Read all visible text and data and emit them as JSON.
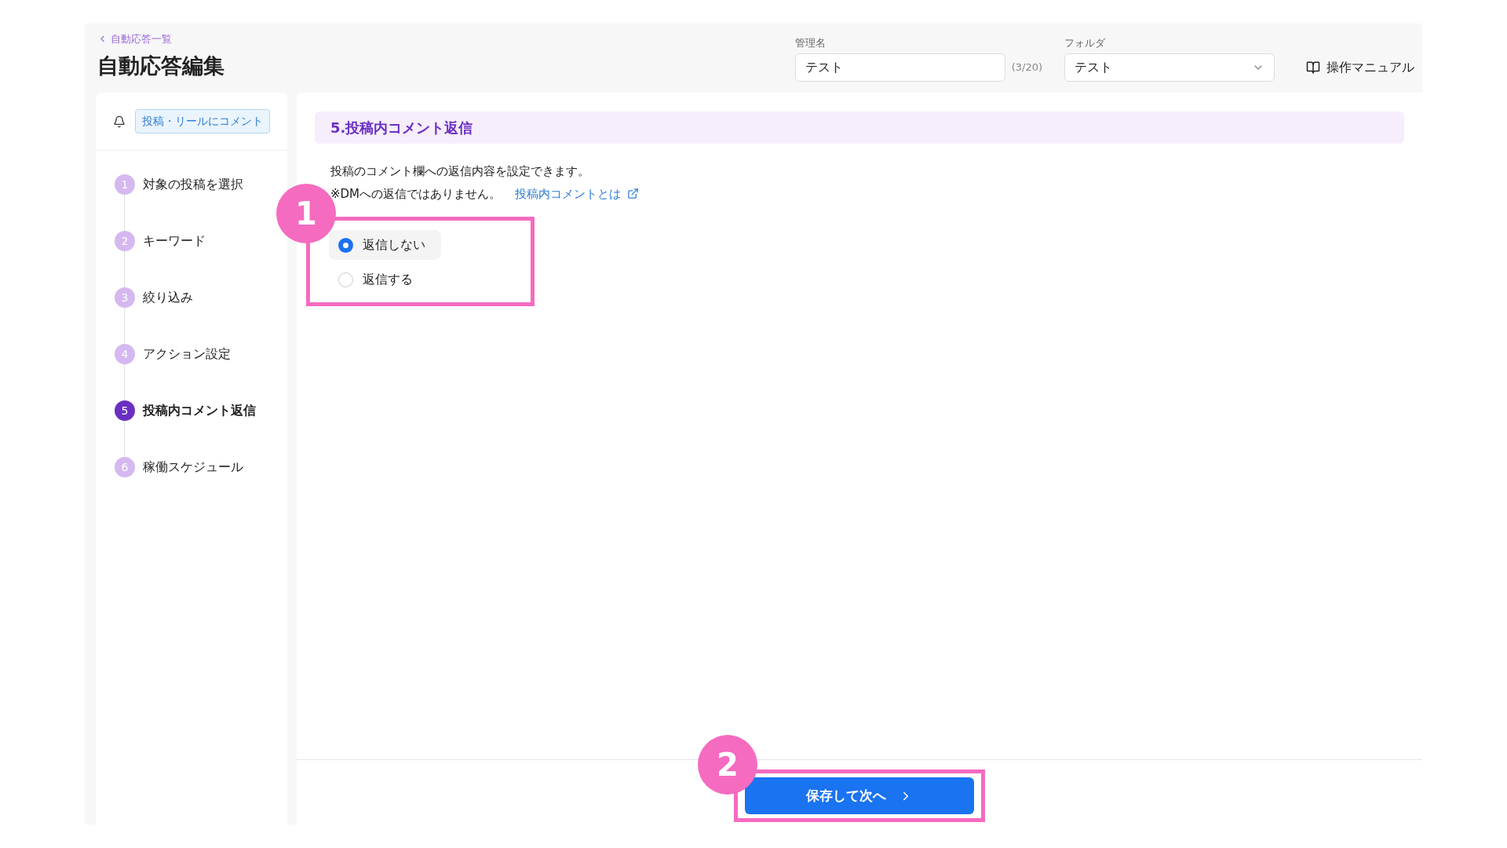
{
  "header": {
    "back_link": "自動応答一覧",
    "title": "自動応答編集",
    "name_field": {
      "label": "管理名",
      "value": "テスト",
      "counter": "(3/20)"
    },
    "folder_field": {
      "label": "フォルダ",
      "value": "テスト"
    },
    "manual_link": "操作マニュアル"
  },
  "sidebar": {
    "trigger_badge": "投稿・リールにコメント",
    "steps": [
      {
        "number": "1",
        "label": "対象の投稿を選択",
        "selected": false
      },
      {
        "number": "2",
        "label": "キーワード",
        "selected": false
      },
      {
        "number": "3",
        "label": "絞り込み",
        "selected": false
      },
      {
        "number": "4",
        "label": "アクション設定",
        "selected": false
      },
      {
        "number": "5",
        "label": "投稿内コメント返信",
        "selected": true
      },
      {
        "number": "6",
        "label": "稼働スケジュール",
        "selected": false
      }
    ]
  },
  "section": {
    "title": "5.投稿内コメント返信",
    "description": "投稿のコメント欄への返信内容を設定できます。",
    "note": "※DMへの返信ではありません。",
    "help_link": "投稿内コメントとは",
    "options": [
      {
        "label": "返信しない",
        "selected": true
      },
      {
        "label": "返信する",
        "selected": false
      }
    ]
  },
  "footer": {
    "next_button": "保存して次へ"
  },
  "callouts": [
    "1",
    "2"
  ]
}
